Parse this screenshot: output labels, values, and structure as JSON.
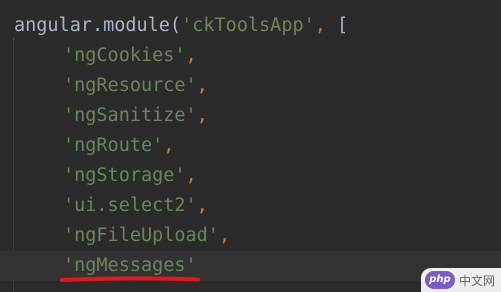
{
  "editor": {
    "line1": {
      "code": "angular.module(",
      "string": "'ckToolsApp'",
      "sep": ",",
      "bracket": " ["
    },
    "lines": [
      {
        "string": "'ngCookies'",
        "sep": ","
      },
      {
        "string": "'ngResource'",
        "sep": ","
      },
      {
        "string": "'ngSanitize'",
        "sep": ","
      },
      {
        "string": "'ngRoute'",
        "sep": ","
      },
      {
        "string": "'ngStorage'",
        "sep": ","
      },
      {
        "string": "'ui.select2'",
        "sep": ","
      },
      {
        "string": "'ngFileUpload'",
        "sep": ","
      },
      {
        "string": "'ngMessages'",
        "sep": ""
      }
    ]
  },
  "colors": {
    "background": "#2b2b2b",
    "current_line": "#323232",
    "string": "#6a8759",
    "punctuation": "#cc7832",
    "plain": "#a9b7c6",
    "annotation": "#e8151b"
  },
  "watermark": {
    "logo": "php",
    "text": "中文网"
  }
}
